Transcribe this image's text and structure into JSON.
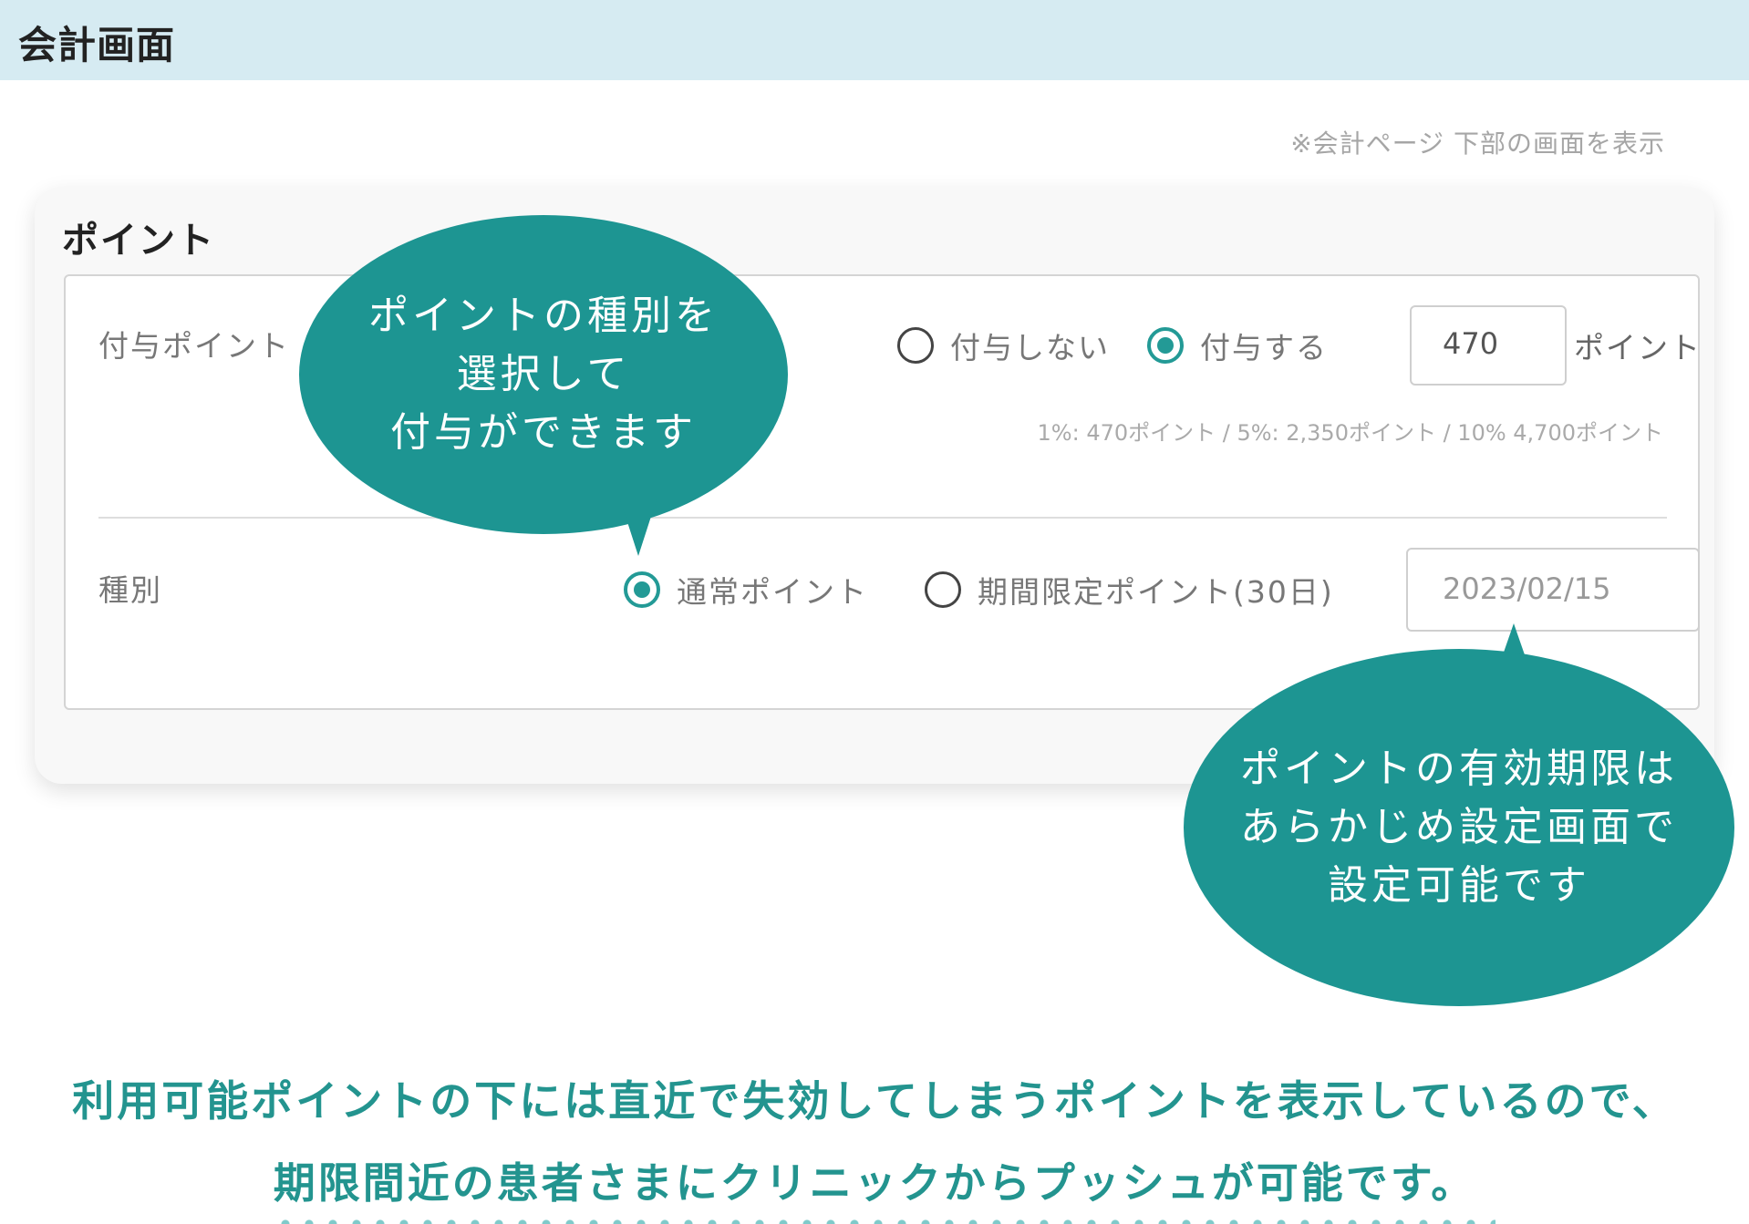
{
  "header": {
    "title": "会計画面"
  },
  "note": "※会計ページ 下部の画面を表示",
  "card": {
    "title": "ポイント",
    "grant_row": {
      "label": "付与ポイント",
      "option_no": "付与しない",
      "option_yes": "付与する",
      "selected": "付与する",
      "points_value": "470",
      "points_unit": "ポイント",
      "hint": "1%: 470ポイント / 5%: 2,350ポイント / 10% 4,700ポイント"
    },
    "type_row": {
      "label": "種別",
      "option_normal": "通常ポイント",
      "option_limited": "期間限定ポイント(30日)",
      "selected": "通常ポイント",
      "expiry_date": "2023/02/15"
    }
  },
  "bubble_type": {
    "line1": "ポイントの種別を",
    "line2": "選択して",
    "line3": "付与ができます"
  },
  "bubble_expiry": {
    "line1": "ポイントの有効期限は",
    "line2": "あらかじめ設定画面で",
    "line3": "設定可能です"
  },
  "caption": {
    "line1": "利用可能ポイントの下には直近で失効してしまうポイントを表示しているので、",
    "line2": "期限間近の患者さまにクリニックからプッシュが可能です。"
  },
  "colors": {
    "accent": "#1d9592",
    "header_bg": "#d6ebf2",
    "caption": "#23948f"
  },
  "icons": [
    "radio-off-icon",
    "radio-on-icon"
  ]
}
